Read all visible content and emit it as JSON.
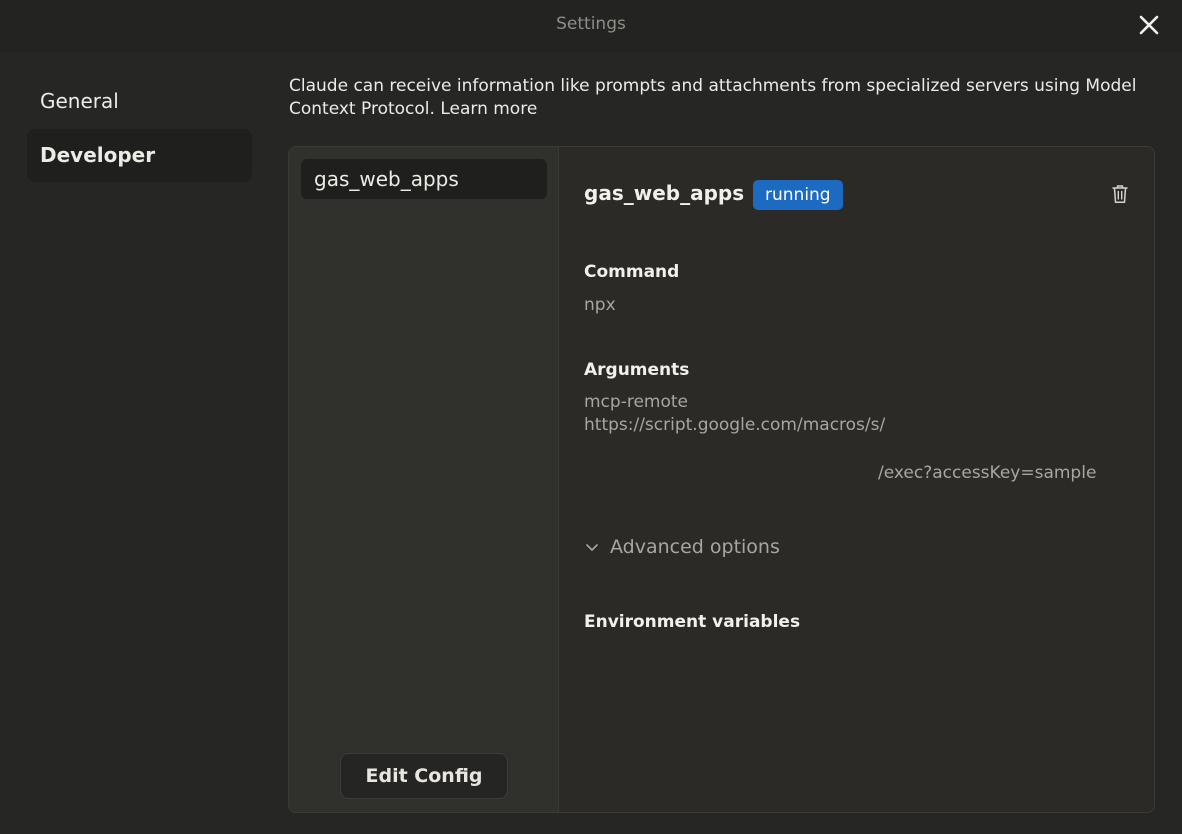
{
  "window": {
    "title": "Settings"
  },
  "nav": {
    "items": [
      {
        "label": "General"
      },
      {
        "label": "Developer"
      }
    ]
  },
  "intro": {
    "text": "Claude can receive information like prompts and attachments from specialized servers using Model Context Protocol.",
    "link": "Learn more"
  },
  "servers": [
    {
      "name": "gas_web_apps"
    }
  ],
  "edit_config_label": "Edit Config",
  "detail": {
    "name": "gas_web_apps",
    "status": "running",
    "command_label": "Command",
    "command": "npx",
    "arguments_label": "Arguments",
    "arguments": [
      "mcp-remote",
      "https://script.google.com/macros/s/",
      "/exec?accessKey=sample"
    ],
    "advanced_label": "Advanced options",
    "env_label": "Environment variables"
  },
  "colors": {
    "background": "#262624",
    "panel": "#2b2a27",
    "status_badge": "#1c6ac2"
  },
  "icons": [
    "close-icon",
    "trash-icon",
    "chevron-down-icon"
  ]
}
